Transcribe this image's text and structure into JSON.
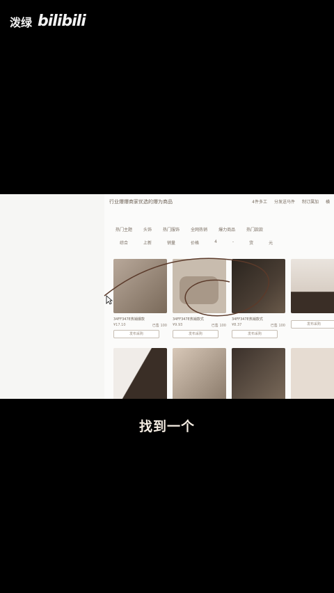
{
  "watermark": {
    "name": "泼绿",
    "logo": "bilibili"
  },
  "browser": {
    "subtitle_line": "行业爆爆商家优选的爆为商品",
    "top_links": [
      "4件多工",
      "分发送马件",
      "制订属加",
      "横"
    ],
    "nav": [
      "热门主题",
      "头饰",
      "热门服饰",
      "全网热销",
      "爆力商品",
      "热门款款"
    ],
    "filters": [
      "综合",
      "上新",
      "销量",
      "价格",
      "4",
      "-",
      "货",
      "元"
    ],
    "products": [
      {
        "title": "34FF347E热销爆款",
        "price": "¥17.10",
        "sold": "已售 100",
        "button": "发布采购"
      },
      {
        "title": "34FF347E热销款式",
        "price": "¥9.93",
        "sold": "已售 100",
        "button": "发布采购"
      },
      {
        "title": "34FF347E热销款式",
        "price": "¥8.37",
        "sold": "已售 100",
        "button": "发布采购"
      },
      {
        "title": "",
        "price": "",
        "sold": "",
        "button": "发布采购"
      }
    ]
  },
  "caption": "找到一个"
}
